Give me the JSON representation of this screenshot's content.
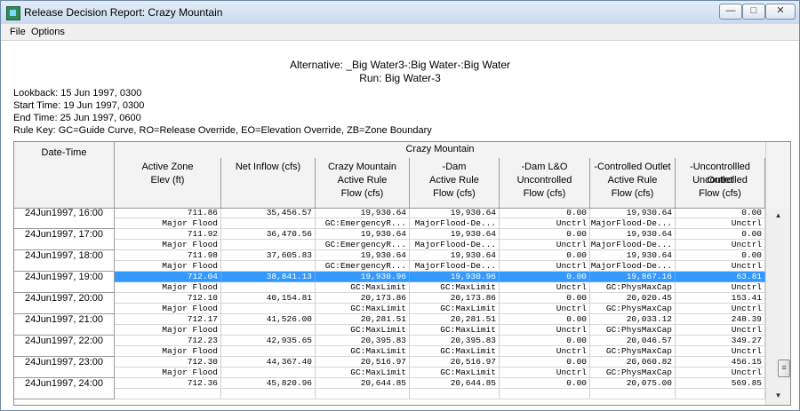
{
  "window": {
    "title": "Release Decision Report: Crazy Mountain",
    "minimize_glyph": "—",
    "maximize_glyph": "□",
    "close_glyph": "✕"
  },
  "menu": {
    "items": [
      "File",
      "Options"
    ]
  },
  "report": {
    "alternative": "Alternative: _Big Water3-:Big Water-:Big Water",
    "run": "Run: Big Water-3",
    "lookback": "Lookback:  15 Jun 1997, 0300",
    "start_time": "Start Time:  19 Jun 1997, 0300",
    "end_time": "End Time:  25 Jun 1997, 0600",
    "rule_key": "Rule Key:  GC=Guide Curve, RO=Release Override, EO=Elevation Override, ZB=Zone Boundary"
  },
  "table": {
    "date_header": "Date-Time",
    "group_header": "Crazy Mountain",
    "columns": [
      [
        "Active Zone",
        "Elev (ft)",
        ""
      ],
      [
        "Net Inflow (cfs)",
        "",
        ""
      ],
      [
        "Crazy Mountain",
        "Active Rule",
        "Flow (cfs)"
      ],
      [
        "-Dam",
        "Active Rule",
        "Flow (cfs)"
      ],
      [
        "-Dam L&O",
        "Uncontrolled",
        "Flow (cfs)"
      ],
      [
        "-Controlled Outlet",
        "Active Rule",
        "Flow (cfs)"
      ],
      [
        "-Uncontrollled Outlet",
        "Uncontrolled",
        "Flow (cfs)"
      ]
    ],
    "rows": [
      {
        "date": "24Jun1997, 16:00",
        "values": [
          "711.86",
          "35,456.57",
          "19,930.64",
          "19,930.64",
          "0.00",
          "19,930.64",
          "0.00"
        ],
        "rules": [
          "Major Flood",
          "",
          "GC:EmergencyR...",
          "MajorFlood-De...",
          "Unctrl",
          "MajorFlood-De...",
          "Unctrl"
        ]
      },
      {
        "date": "24Jun1997, 17:00",
        "values": [
          "711.92",
          "36,470.56",
          "19,930.64",
          "19,930.64",
          "0.00",
          "19,930.64",
          "0.00"
        ],
        "rules": [
          "Major Flood",
          "",
          "GC:EmergencyR...",
          "MajorFlood-De...",
          "Unctrl",
          "MajorFlood-De...",
          "Unctrl"
        ]
      },
      {
        "date": "24Jun1997, 18:00",
        "values": [
          "711.98",
          "37,605.83",
          "19,930.64",
          "19,930.64",
          "0.00",
          "19,930.64",
          "0.00"
        ],
        "rules": [
          "Major Flood",
          "",
          "GC:EmergencyR...",
          "MajorFlood-De...",
          "Unctrl",
          "MajorFlood-De...",
          "Unctrl"
        ]
      },
      {
        "date": "24Jun1997, 19:00",
        "values": [
          "712.04",
          "38,841.13",
          "19,930.96",
          "19,930.96",
          "0.00",
          "19,867.16",
          "63.81"
        ],
        "rules": [
          "Major Flood",
          "",
          "GC:MaxLimit",
          "GC:MaxLimit",
          "Unctrl",
          "GC:PhysMaxCap",
          "Unctrl"
        ]
      },
      {
        "date": "24Jun1997, 20:00",
        "values": [
          "712.10",
          "40,154.81",
          "20,173.86",
          "20,173.86",
          "0.00",
          "20,020.45",
          "153.41"
        ],
        "rules": [
          "Major Flood",
          "",
          "GC:MaxLimit",
          "GC:MaxLimit",
          "Unctrl",
          "GC:PhysMaxCap",
          "Unctrl"
        ]
      },
      {
        "date": "24Jun1997, 21:00",
        "values": [
          "712.17",
          "41,526.00",
          "20,281.51",
          "20,281.51",
          "0.00",
          "20,033.12",
          "248.39"
        ],
        "rules": [
          "Major Flood",
          "",
          "GC:MaxLimit",
          "GC:MaxLimit",
          "Unctrl",
          "GC:PhysMaxCap",
          "Unctrl"
        ]
      },
      {
        "date": "24Jun1997, 22:00",
        "values": [
          "712.23",
          "42,935.65",
          "20,395.83",
          "20,395.83",
          "0.00",
          "20,046.57",
          "349.27"
        ],
        "rules": [
          "Major Flood",
          "",
          "GC:MaxLimit",
          "GC:MaxLimit",
          "Unctrl",
          "GC:PhysMaxCap",
          "Unctrl"
        ]
      },
      {
        "date": "24Jun1997, 23:00",
        "values": [
          "712.30",
          "44,367.40",
          "20,516.97",
          "20,516.97",
          "0.00",
          "20,060.82",
          "456.15"
        ],
        "rules": [
          "Major Flood",
          "",
          "GC:MaxLimit",
          "GC:MaxLimit",
          "Unctrl",
          "GC:PhysMaxCap",
          "Unctrl"
        ]
      },
      {
        "date": "24Jun1997, 24:00",
        "values": [
          "712.36",
          "45,820.96",
          "20,644.85",
          "20,644.85",
          "0.00",
          "20,075.00",
          "569.85"
        ],
        "rules": [
          "",
          "",
          "",
          "",
          "",
          "",
          ""
        ]
      }
    ],
    "selected_row": 3
  },
  "scrollbar": {
    "up_glyph": "▲",
    "down_glyph": "▼",
    "grip_glyph": "≡"
  },
  "colors": {
    "selection": "#3399ff",
    "title_bar": "#c9daee"
  }
}
